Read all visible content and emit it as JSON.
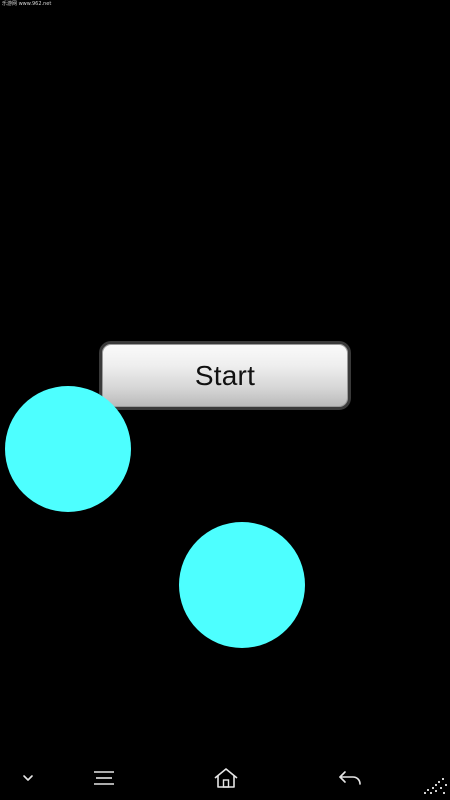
{
  "watermark": {
    "text": "乐游网 www.962.net"
  },
  "game": {
    "start_label": "Start",
    "ball_color": "#4dffff",
    "background_color": "#000000"
  },
  "navbar": {
    "items": [
      {
        "icon": "chevron-down-icon"
      },
      {
        "icon": "menu-icon"
      },
      {
        "icon": "home-icon"
      },
      {
        "icon": "back-icon"
      }
    ]
  }
}
